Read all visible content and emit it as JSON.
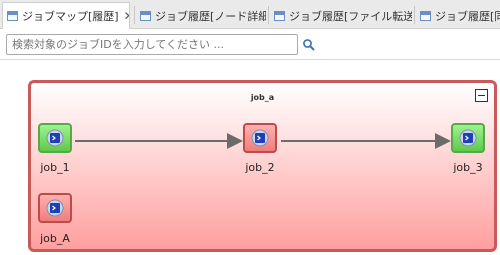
{
  "tabs": [
    {
      "label": "ジョブマップ[履歴]",
      "active": true,
      "close": "✕"
    },
    {
      "label": "ジョブ履歴[ノード詳細]",
      "active": false
    },
    {
      "label": "ジョブ履歴[ファイル転送]",
      "active": false
    },
    {
      "label": "ジョブ履歴[同",
      "active": false
    }
  ],
  "search": {
    "placeholder": "検索対象のジョブIDを入力してください ..."
  },
  "map": {
    "group_title": "job_a",
    "nodes": [
      {
        "id": "job_1",
        "label": "job_1",
        "status": "ok"
      },
      {
        "id": "job_2",
        "label": "job_2",
        "status": "error"
      },
      {
        "id": "job_3",
        "label": "job_3",
        "status": "ok"
      },
      {
        "id": "job_A",
        "label": "job_A",
        "status": "error"
      }
    ],
    "edges": [
      {
        "from": "job_1",
        "to": "job_2"
      },
      {
        "from": "job_2",
        "to": "job_3"
      }
    ]
  },
  "colors": {
    "ok": "#5fc94c",
    "error": "#ef7d7d",
    "group_border": "#c95a5a"
  },
  "icons": {
    "tab": "job-map-view-icon",
    "search": "search-icon",
    "collapse": "collapse-icon",
    "node": "job-icon"
  }
}
